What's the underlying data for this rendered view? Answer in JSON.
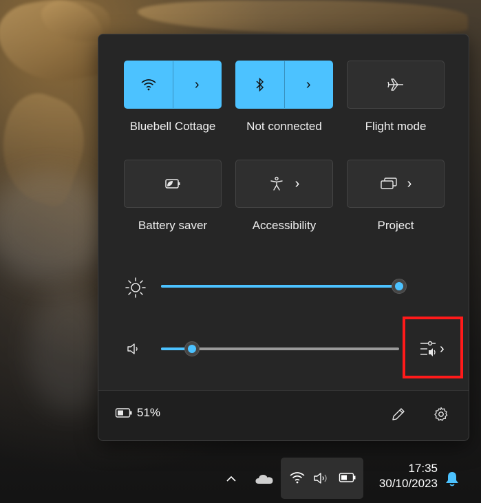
{
  "colors": {
    "accent": "#4cc2ff",
    "highlight": "#ff1a1a",
    "panel": "#262626"
  },
  "quick_settings": {
    "tiles": [
      {
        "label": "Bluebell Cottage",
        "icon": "wifi-icon",
        "active": true,
        "expandable": true
      },
      {
        "label": "Not connected",
        "icon": "bluetooth-icon",
        "active": true,
        "expandable": true
      },
      {
        "label": "Flight mode",
        "icon": "airplane-icon",
        "active": false,
        "expandable": false
      },
      {
        "label": "Battery saver",
        "icon": "battery-saver-icon",
        "active": false,
        "expandable": false
      },
      {
        "label": "Accessibility",
        "icon": "accessibility-icon",
        "active": false,
        "expandable": true
      },
      {
        "label": "Project",
        "icon": "project-icon",
        "active": false,
        "expandable": true
      }
    ],
    "brightness": {
      "icon": "brightness-icon",
      "level": 1.0
    },
    "volume": {
      "icon": "volume-icon",
      "level": 0.13,
      "mixer_icon": "volume-mixer-icon"
    },
    "footer": {
      "battery_percent": "51%",
      "battery_icon": "battery-icon",
      "edit_icon": "pencil-icon",
      "settings_icon": "gear-icon"
    }
  },
  "taskbar": {
    "tray_icons": [
      "chevron-up-icon",
      "onedrive-cloud-icon",
      "wifi-icon",
      "volume-icon",
      "battery-icon",
      "notification-bell-icon"
    ],
    "time": "17:35",
    "date": "30/10/2023"
  }
}
